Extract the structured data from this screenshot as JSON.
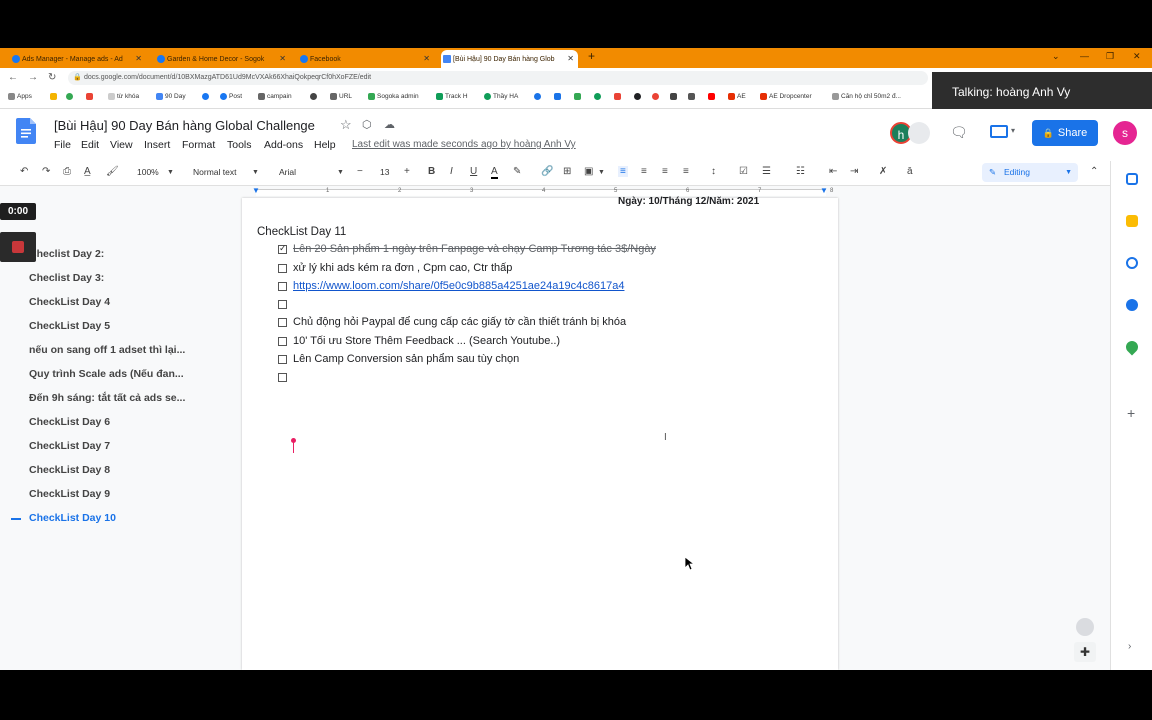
{
  "browser": {
    "tabs": [
      {
        "label": "Ads Manager - Manage ads - Ad",
        "active": false
      },
      {
        "label": "Garden & Home Decor - Sogok",
        "active": false
      },
      {
        "label": "Facebook",
        "active": false
      },
      {
        "label": "[Bùi Hậu] 90 Day Bán hàng Glob",
        "active": true
      }
    ],
    "url": "docs.google.com/document/d/10BXMazgATD61Ud9McVXAk66XhaiQokpeqrCf0hXoFZE/edit",
    "bookmarks": [
      "Apps",
      "từ khóa",
      "90 Day",
      "Post",
      "campain",
      "URL",
      "Sogoka admin",
      "Track H",
      "Thầy HA",
      "AE",
      "AE Dropcenter",
      "Căn hộ chỉ 50m2 đ..."
    ]
  },
  "overlay": {
    "talking": "Talking: hoàng Anh Vy",
    "timer": "0:00"
  },
  "doc": {
    "title": "[Bùi Hậu] 90 Day Bán hàng Global Challenge",
    "menu": [
      "File",
      "Edit",
      "View",
      "Insert",
      "Format",
      "Tools",
      "Add-ons",
      "Help"
    ],
    "last_edit": "Last edit was made seconds ago by hoàng Anh Vy",
    "share_label": "Share",
    "avatar_letter": "s",
    "collab_letter": "h"
  },
  "toolbar": {
    "zoom": "100%",
    "style": "Normal text",
    "font": "Arial",
    "size": "13",
    "mode": "Editing"
  },
  "ruler": [
    "1",
    "2",
    "3",
    "4",
    "5",
    "6",
    "7",
    "8"
  ],
  "outline": [
    {
      "label": "Checlist Day 2:",
      "active": false
    },
    {
      "label": "Checlist Day 3:",
      "active": false
    },
    {
      "label": "CheckList Day 4",
      "active": false
    },
    {
      "label": "CheckList Day 5",
      "active": false
    },
    {
      "label": "nếu on sang off 1 adset thì lại...",
      "active": false
    },
    {
      "label": "Quy trình Scale ads (Nếu đan...",
      "active": false
    },
    {
      "label": "Đến 9h sáng: tắt tất cả ads se...",
      "active": false
    },
    {
      "label": "CheckList Day 6",
      "active": false
    },
    {
      "label": "CheckList Day 7",
      "active": false
    },
    {
      "label": "CheckList Day 8",
      "active": false
    },
    {
      "label": "CheckList Day 9",
      "active": false
    },
    {
      "label": "CheckList Day 10",
      "active": true
    }
  ],
  "content": {
    "date_line": "Ngày: 10/Tháng 12/Năm: 2021",
    "heading": "CheckList Day 11",
    "items": [
      {
        "text": "Lên 20 Sản phẩm 1 ngày trên Fanpage và chạy Camp Tương tác 3$/Ngày",
        "checked": true,
        "style": "strike"
      },
      {
        "text": "xử lý khi ads kém ra đơn , Cpm cao, Ctr thấp",
        "checked": false,
        "style": "normal"
      },
      {
        "text": "https://www.loom.com/share/0f5e0c9b885a4251ae24a19c4c8617a4",
        "checked": false,
        "style": "link"
      },
      {
        "text": "",
        "checked": false,
        "style": "normal"
      },
      {
        "text": "Chủ động hỏi Paypal để cung cấp các giấy tờ cần thiết tránh bị khóa",
        "checked": false,
        "style": "normal"
      },
      {
        "text": "10' Tối ưu Store Thêm Feedback ... (Search Youtube..)",
        "checked": false,
        "style": "normal"
      },
      {
        "text": "Lên Camp Conversion  sản phẩm sau tùy chọn",
        "checked": false,
        "style": "normal"
      },
      {
        "text": "",
        "checked": false,
        "style": "normal"
      }
    ]
  },
  "colors": {
    "tabstrip": "#f28b00",
    "accent": "#1a73e8",
    "share": "#1a73e8"
  }
}
